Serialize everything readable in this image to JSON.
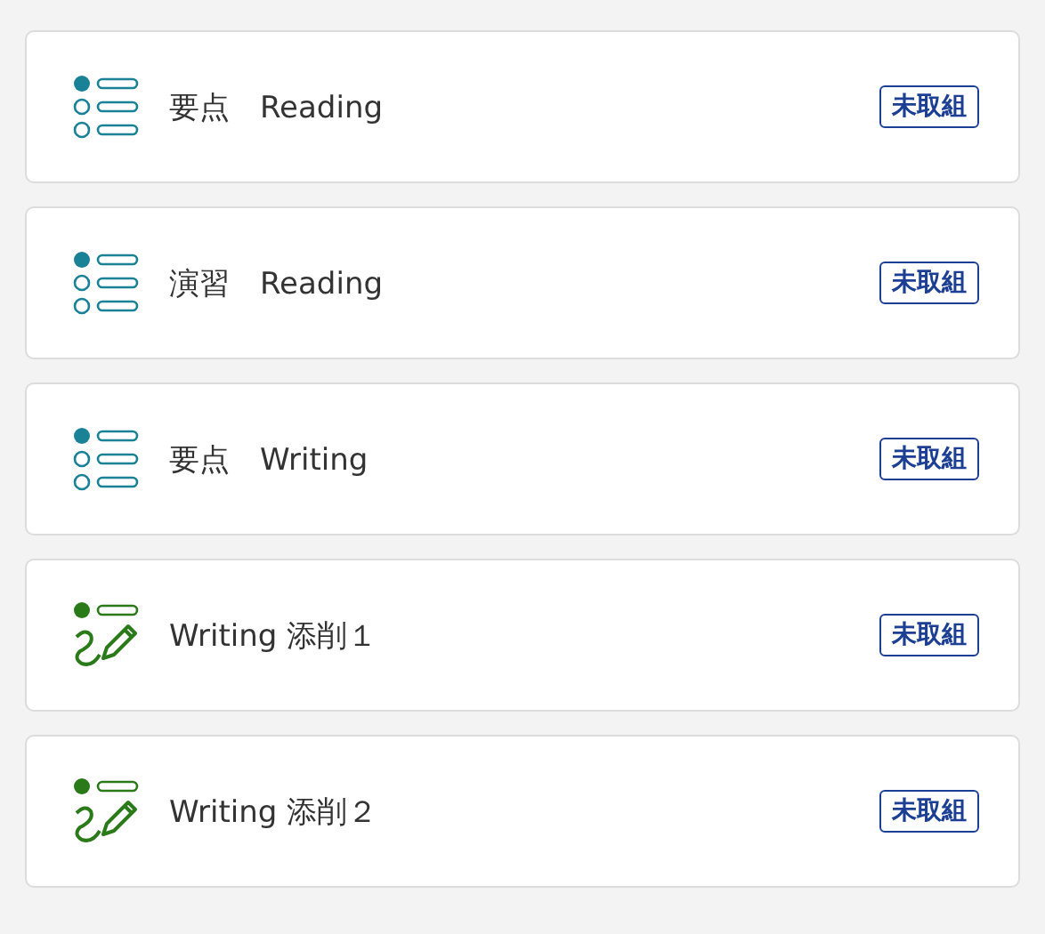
{
  "items": [
    {
      "kind": "quiz",
      "title": "要点　Reading",
      "status": "未取組"
    },
    {
      "kind": "quiz",
      "title": "演習　Reading",
      "status": "未取組"
    },
    {
      "kind": "quiz",
      "title": "要点　Writing",
      "status": "未取組"
    },
    {
      "kind": "writing",
      "title": "Writing 添削１",
      "status": "未取組"
    },
    {
      "kind": "writing",
      "title": "Writing 添削２",
      "status": "未取組"
    }
  ]
}
